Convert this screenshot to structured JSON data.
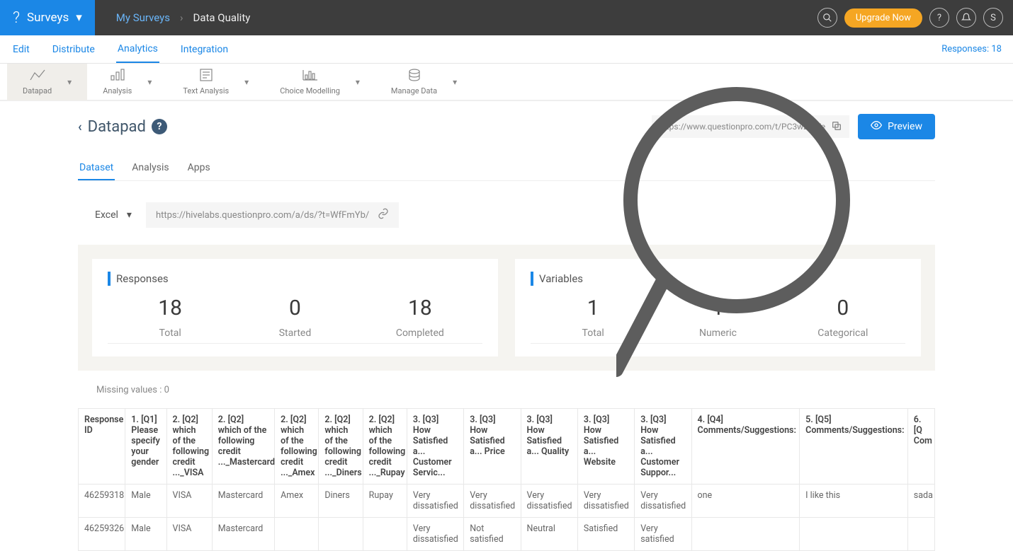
{
  "topbar": {
    "brand_label": "Surveys",
    "breadcrumb_parent": "My Surveys",
    "breadcrumb_current": "Data Quality",
    "upgrade_label": "Upgrade Now",
    "avatar_initial": "S"
  },
  "subnav": {
    "items": [
      {
        "label": "Edit"
      },
      {
        "label": "Distribute"
      },
      {
        "label": "Analytics",
        "selected": true
      },
      {
        "label": "Integration"
      }
    ],
    "responses_label": "Responses: 18"
  },
  "toolbar": {
    "items": [
      {
        "label": "Datapad",
        "selected": true
      },
      {
        "label": "Analysis"
      },
      {
        "label": "Text Analysis"
      },
      {
        "label": "Choice Modelling"
      },
      {
        "label": "Manage Data"
      }
    ]
  },
  "page": {
    "title": "Datapad",
    "share_url": "https://www.questionpro.com/t/PC3wZRIYe",
    "preview_label": "Preview"
  },
  "main_tabs": [
    {
      "label": "Dataset",
      "selected": true
    },
    {
      "label": "Analysis"
    },
    {
      "label": "Apps"
    }
  ],
  "excel_row": {
    "select_label": "Excel",
    "url": "https://hivelabs.questionpro.com/a/ds/?t=WfFmYb/"
  },
  "summary": {
    "responses": {
      "title": "Responses",
      "stats": [
        {
          "num": "18",
          "lbl": "Total"
        },
        {
          "num": "0",
          "lbl": "Started"
        },
        {
          "num": "18",
          "lbl": "Completed"
        }
      ]
    },
    "variables": {
      "title": "Variables",
      "stats": [
        {
          "num": "1",
          "lbl": "Total"
        },
        {
          "num": "1",
          "lbl": "Numeric"
        },
        {
          "num": "0",
          "lbl": "Categorical"
        }
      ]
    }
  },
  "missing_values": "Missing values : 0",
  "table": {
    "headers": [
      "Response ID",
      "1. [Q1] Please specify your gender",
      "2. [Q2] which of the following credit ..._VISA",
      "2. [Q2] which of the following credit ..._Mastercard",
      "2. [Q2] which of the following credit ..._Amex",
      "2. [Q2] which of the following credit ..._Diners",
      "2. [Q2] which of the following credit ..._Rupay",
      "3. [Q3] How Satisfied a... Customer Servic...",
      "3. [Q3] How Satisfied a... Price",
      "3. [Q3] How Satisfied a... Quality",
      "3. [Q3] How Satisfied a... Website",
      "3. [Q3] How Satisfied a... Customer Suppor...",
      "4. [Q4] Comments/Suggestions:",
      "5. [Q5] Comments/Suggestions:",
      "6. [Q Com"
    ],
    "rows": [
      [
        "46259318",
        "Male",
        "VISA",
        "Mastercard",
        "Amex",
        "Diners",
        "Rupay",
        "Very dissatisfied",
        "Very dissatisfied",
        "Very dissatisfied",
        "Very dissatisfied",
        "Very dissatisfied",
        "one",
        "I like this",
        "sada"
      ],
      [
        "46259326",
        "Male",
        "VISA",
        "Mastercard",
        "",
        "",
        "",
        "Very dissatisfied",
        "Not satisfied",
        "Neutral",
        "Satisfied",
        "Very satisfied",
        "",
        "",
        ""
      ]
    ]
  }
}
